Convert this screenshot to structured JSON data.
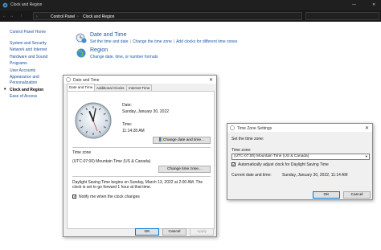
{
  "window": {
    "title": "Clock and Region",
    "minimize": "—",
    "close": "✕"
  },
  "address": {
    "back": "←",
    "forward": "→",
    "up": "↑",
    "segments": [
      "Control Panel",
      "Clock and Region"
    ],
    "separator": "›"
  },
  "sidebar": {
    "items": [
      {
        "label": "Control Panel Home",
        "active": false
      },
      {
        "label": "System and Security",
        "active": false
      },
      {
        "label": "Network and Internet",
        "active": false
      },
      {
        "label": "Hardware and Sound",
        "active": false
      },
      {
        "label": "Programs",
        "active": false
      },
      {
        "label": "User Accounts",
        "active": false
      },
      {
        "label": "Appearance and Personalization",
        "active": false
      },
      {
        "label": "Clock and Region",
        "active": true
      },
      {
        "label": "Ease of Access",
        "active": false
      }
    ]
  },
  "sections": {
    "datetime": {
      "heading": "Date and Time",
      "links": [
        "Set the time and date",
        "Change the time zone",
        "Add clocks for different time zones"
      ]
    },
    "region": {
      "heading": "Region",
      "links": [
        "Change date, time, or number formats"
      ]
    }
  },
  "dt_dialog": {
    "title": "Date and Time",
    "tabs": [
      "Date and Time",
      "Additional Clocks",
      "Internet Time"
    ],
    "date_label": "Date:",
    "date_value": "Sunday, January 30, 2022",
    "time_label": "Time:",
    "time_value": "11:14:28 AM",
    "change_dt_button": "Change date and time...",
    "tz_label": "Time zone",
    "tz_value": "(UTC-07:00) Mountain Time (US & Canada)",
    "change_tz_button": "Change time zone...",
    "dst_text_1": "Daylight Saving Time begins on Sunday, March 13, 2022 at 2:00 AM. The",
    "dst_text_2": "clock is set to go forward 1 hour at that time.",
    "notify_label": "Notify me when the clock changes",
    "ok": "OK",
    "cancel": "Cancel",
    "apply": "Apply"
  },
  "tz_dialog": {
    "title": "Time Zone Settings",
    "instruction": "Set the time zone:",
    "tz_label": "Time zone:",
    "tz_value": "(UTC-07:00) Mountain Time (US & Canada)",
    "dst_label": "Automatically adjust clock for Daylight Saving Time",
    "current_label": "Current date and time:",
    "current_value": "Sunday, January 30, 2022, 11:14 AM",
    "ok": "OK",
    "cancel": "Cancel"
  },
  "colors": {
    "link": "#1e5aa8",
    "titlebar": "#1f1f1f",
    "dialog_bg": "#f0f0f0",
    "accent": "#0078d7"
  }
}
